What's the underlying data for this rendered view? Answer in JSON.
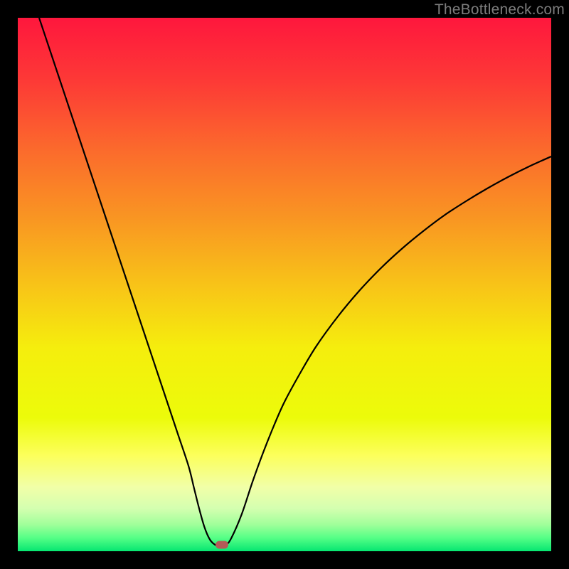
{
  "watermark": "TheBottleneck.com",
  "chart_data": {
    "type": "line",
    "title": "",
    "xlabel": "",
    "ylabel": "",
    "xlim": [
      0,
      100
    ],
    "ylim": [
      0,
      100
    ],
    "series": [
      {
        "name": "curve",
        "x": [
          4,
          6,
          8,
          10,
          12,
          14,
          16,
          18,
          20,
          22,
          24,
          26,
          28,
          30,
          32,
          33,
          34,
          35,
          36,
          37,
          38,
          39,
          40,
          42,
          44,
          46,
          48,
          50,
          53,
          56,
          60,
          64,
          68,
          72,
          76,
          80,
          84,
          88,
          92,
          96,
          100
        ],
        "y": [
          100,
          94,
          88,
          82,
          76,
          70,
          64,
          58,
          52,
          46,
          40,
          34,
          28,
          22,
          16,
          12,
          8,
          4.5,
          2.2,
          1.2,
          1.0,
          1.2,
          2.4,
          7,
          13,
          18.5,
          23.5,
          28,
          33.5,
          38.5,
          44,
          48.8,
          53,
          56.7,
          60,
          63,
          65.6,
          68,
          70.2,
          72.2,
          74
        ]
      }
    ],
    "marker": {
      "x": 38.3,
      "y": 1.2
    },
    "gradient_stops": [
      {
        "pos": 0.0,
        "color": "#fe173d"
      },
      {
        "pos": 0.12,
        "color": "#fd3a36"
      },
      {
        "pos": 0.25,
        "color": "#fb6b2c"
      },
      {
        "pos": 0.38,
        "color": "#f99722"
      },
      {
        "pos": 0.5,
        "color": "#f8c318"
      },
      {
        "pos": 0.62,
        "color": "#f5ee0d"
      },
      {
        "pos": 0.75,
        "color": "#ecfb0a"
      },
      {
        "pos": 0.82,
        "color": "#fcff5b"
      },
      {
        "pos": 0.88,
        "color": "#f1ffa8"
      },
      {
        "pos": 0.92,
        "color": "#d4ffb0"
      },
      {
        "pos": 0.95,
        "color": "#a0ff9a"
      },
      {
        "pos": 0.975,
        "color": "#55ff86"
      },
      {
        "pos": 1.0,
        "color": "#06e671"
      }
    ]
  }
}
